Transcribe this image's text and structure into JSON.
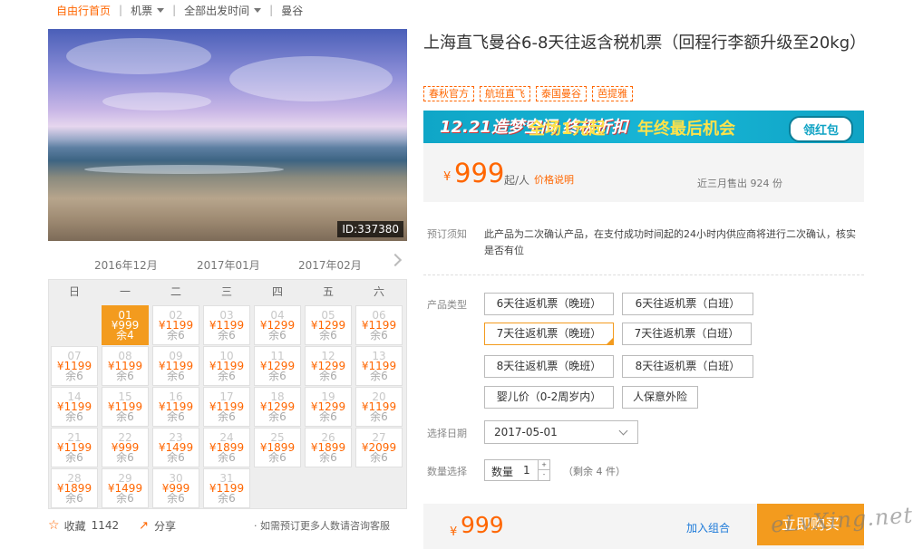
{
  "breadcrumb": {
    "home": "自由行首页",
    "category": "机票",
    "departure": "全部出发时间",
    "destination": "曼谷"
  },
  "hero": {
    "id_tag": "ID:337380"
  },
  "calendar": {
    "months": [
      "2016年12月",
      "2017年01月",
      "2017年02月"
    ],
    "weekdays": [
      "日",
      "一",
      "二",
      "三",
      "四",
      "五",
      "六"
    ],
    "days": [
      {
        "d": "01",
        "p": "¥999",
        "s": "余4",
        "sel": true
      },
      {
        "d": "02",
        "p": "¥1199",
        "s": "余6"
      },
      {
        "d": "03",
        "p": "¥1199",
        "s": "余6"
      },
      {
        "d": "04",
        "p": "¥1299",
        "s": "余6"
      },
      {
        "d": "05",
        "p": "¥1299",
        "s": "余6"
      },
      {
        "d": "06",
        "p": "¥1199",
        "s": "余6"
      },
      {
        "d": "07",
        "p": "¥1199",
        "s": "余6"
      },
      {
        "d": "08",
        "p": "¥1199",
        "s": "余6"
      },
      {
        "d": "09",
        "p": "¥1199",
        "s": "余6"
      },
      {
        "d": "10",
        "p": "¥1199",
        "s": "余6"
      },
      {
        "d": "11",
        "p": "¥1299",
        "s": "余6"
      },
      {
        "d": "12",
        "p": "¥1299",
        "s": "余6"
      },
      {
        "d": "13",
        "p": "¥1199",
        "s": "余6"
      },
      {
        "d": "14",
        "p": "¥1199",
        "s": "余6"
      },
      {
        "d": "15",
        "p": "¥1199",
        "s": "余6"
      },
      {
        "d": "16",
        "p": "¥1199",
        "s": "余6"
      },
      {
        "d": "17",
        "p": "¥1199",
        "s": "余6"
      },
      {
        "d": "18",
        "p": "¥1299",
        "s": "余6"
      },
      {
        "d": "19",
        "p": "¥1299",
        "s": "余6"
      },
      {
        "d": "20",
        "p": "¥1199",
        "s": "余6"
      },
      {
        "d": "21",
        "p": "¥1199",
        "s": "余6"
      },
      {
        "d": "22",
        "p": "¥999",
        "s": "余6"
      },
      {
        "d": "23",
        "p": "¥1499",
        "s": "余6"
      },
      {
        "d": "24",
        "p": "¥1899",
        "s": "余6"
      },
      {
        "d": "25",
        "p": "¥1899",
        "s": "余6"
      },
      {
        "d": "26",
        "p": "¥1899",
        "s": "余6"
      },
      {
        "d": "27",
        "p": "¥2099",
        "s": "余6"
      },
      {
        "d": "28",
        "p": "¥1899",
        "s": "余6"
      },
      {
        "d": "29",
        "p": "¥1499",
        "s": "余6"
      },
      {
        "d": "30",
        "p": "¥999",
        "s": "余6"
      },
      {
        "d": "31",
        "p": "¥1199",
        "s": "余6"
      }
    ]
  },
  "actions": {
    "favorite_label": "收藏",
    "favorite_count": "1142",
    "share_label": "分享",
    "note": "· 如需预订更多人数请咨询客服"
  },
  "product": {
    "title": "上海直飞曼谷6-8天往返含税机票（回程行李额升级至20kg）",
    "tags": [
      "春秋官方",
      "航班直飞",
      "泰国曼谷",
      "芭提雅"
    ],
    "banner": {
      "part1": "12.21造梦空间 终极折扣",
      "part2": "全场1元起",
      "part3": "年终最后机会",
      "button": "领红包"
    },
    "price": {
      "currency": "¥",
      "value": "999",
      "suffix": "起/人",
      "explain": "价格说明",
      "sold": "近三月售出 924 份"
    },
    "notice": {
      "label": "预订须知",
      "text": "此产品为二次确认产品，在支付成功时间起的24小时内供应商将进行二次确认，核实是否有位"
    },
    "options": {
      "type_label": "产品类型",
      "types": [
        "6天往返机票（晚班）",
        "6天往返机票（白班）",
        "7天往返机票（晚班）",
        "7天往返机票（白班）",
        "8天往返机票（晚班）",
        "8天往返机票（白班）",
        "婴儿价（0-2周岁内）",
        "人保意外险"
      ],
      "selected_type": "7天往返机票（晚班）",
      "date_label": "选择日期",
      "date_value": "2017-05-01",
      "qty_label": "数量选择",
      "qty_prefix": "数量",
      "qty_value": "1",
      "remain": "（剩余 4 件）"
    },
    "buy": {
      "currency": "¥",
      "value": "999",
      "add_combo": "加入组合",
      "buy_now": "立即购买"
    }
  },
  "watermark": "eLvXing.net",
  "colors": {
    "accent": "#f60",
    "selected": "#f39b1e",
    "link": "#1d7ad9"
  }
}
